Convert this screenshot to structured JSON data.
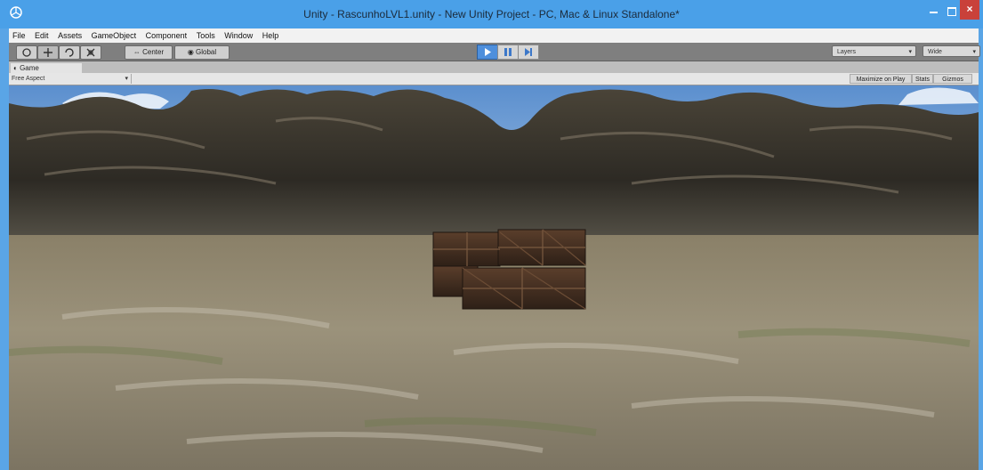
{
  "window": {
    "title": "Unity - RascunhoLVL1.unity - New Unity Project - PC, Mac & Linux Standalone*",
    "close_label": "×"
  },
  "menu": [
    "File",
    "Edit",
    "Assets",
    "GameObject",
    "Component",
    "Tools",
    "Window",
    "Help"
  ],
  "toolbar": {
    "pivot_label": "Center",
    "space_label": "Global",
    "layers_label": "Layers",
    "layout_label": "Wide"
  },
  "game_view": {
    "tab_label": "Game",
    "aspect_label": "Free Aspect",
    "maximize_label": "Maximize on Play",
    "stats_label": "Stats",
    "gizmos_label": "Gizmos"
  },
  "colors": {
    "titlebar": "#4aa0e8",
    "play_active": "#4e8fdc",
    "close": "#c9413a"
  }
}
